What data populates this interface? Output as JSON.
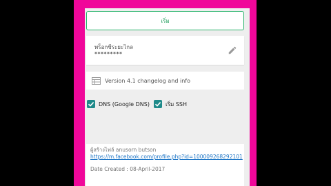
{
  "start_button": {
    "label": "เริ่ม"
  },
  "proxy": {
    "label": "พร็อกซีระยะไกล",
    "value": "*********"
  },
  "changelog": {
    "label": "Version 4.1 changelog and info"
  },
  "options": [
    {
      "label": "DNS (Google DNS)",
      "checked": true
    },
    {
      "label": "เริ่ม SSH",
      "checked": true
    }
  ],
  "footer": {
    "author": "ผู้สร้างไฟล์ anusorn butson",
    "link": "https://m.facebook.com/profile.php?id=100009268292101",
    "date": "Date Created : 08-April-2017"
  },
  "colors": {
    "background": "#f0079a",
    "accent": "#1d9c5a",
    "checkbox": "#1e8a8a",
    "link": "#1a73c5"
  },
  "icons": {
    "edit": "pencil-icon",
    "changelog": "table-icon",
    "check": "checkmark-icon"
  }
}
